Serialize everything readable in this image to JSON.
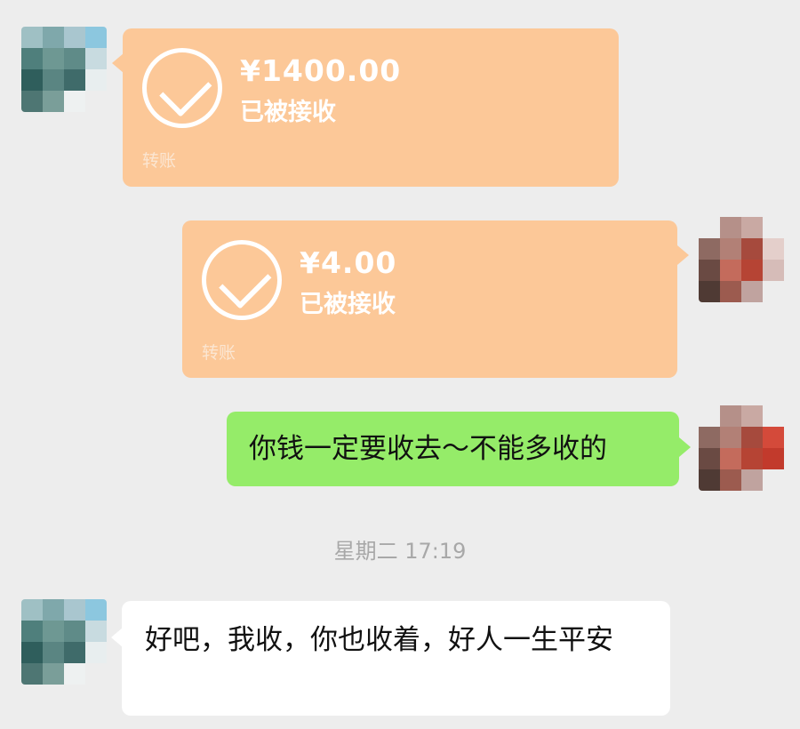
{
  "messages": [
    {
      "type": "transfer",
      "side": "left",
      "amount": "¥1400.00",
      "status": "已被接收",
      "label": "转账"
    },
    {
      "type": "transfer",
      "side": "right",
      "amount": "¥4.00",
      "status": "已被接收",
      "label": "转账"
    },
    {
      "type": "text",
      "side": "right",
      "text": "你钱一定要收去～不能多收的"
    },
    {
      "type": "timestamp",
      "text": "星期二 17:19"
    },
    {
      "type": "text",
      "side": "left",
      "text": "好吧，我收，你也收着，好人一生平安"
    }
  ],
  "colors": {
    "background": "#ededed",
    "transfer_bubble": "#fcc898",
    "sent_bubble": "#95ec69",
    "received_bubble": "#ffffff"
  },
  "icons": {
    "transfer_status": "checkmark-circle-icon",
    "avatar": "pixelated-avatar"
  }
}
